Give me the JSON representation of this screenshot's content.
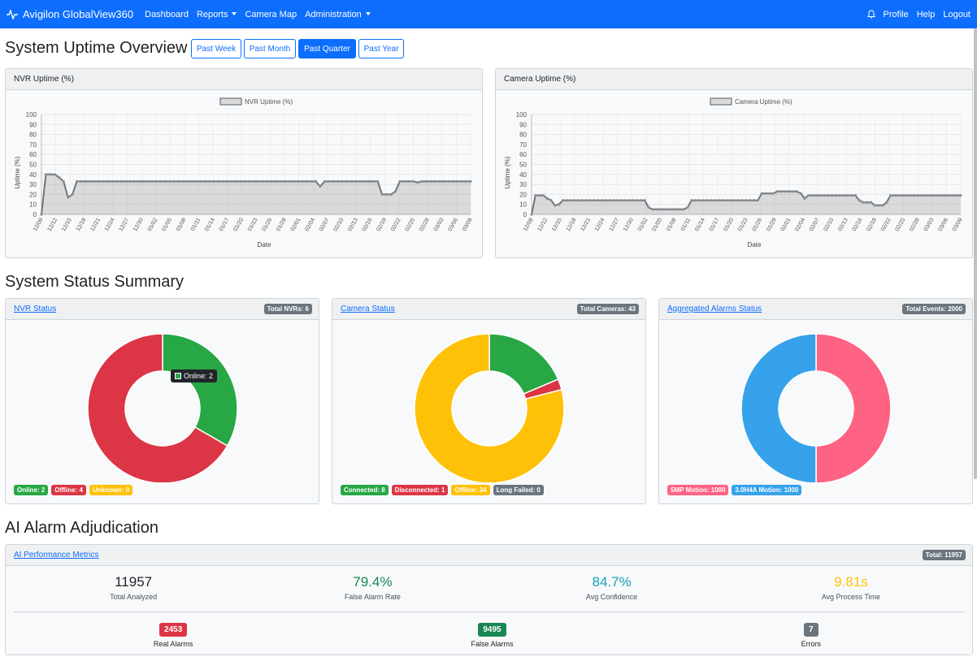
{
  "nav": {
    "brand": "Avigilon GlobalView360",
    "links": [
      "Dashboard",
      "Reports",
      "Camera Map",
      "Administration"
    ],
    "right": [
      "Profile",
      "Help",
      "Logout"
    ]
  },
  "uptime": {
    "title": "System Uptime Overview",
    "ranges": [
      "Past Week",
      "Past Month",
      "Past Quarter",
      "Past Year"
    ],
    "active_range": "Past Quarter"
  },
  "status": {
    "title": "System Status Summary"
  },
  "ai": {
    "title": "AI Alarm Adjudication"
  },
  "colors": {
    "primary": "#0d6efd",
    "success": "#28a745",
    "danger": "#dc3545",
    "warning": "#ffc107",
    "secondary": "#6c757d",
    "pink": "#ff6384",
    "blue": "#36a2eb",
    "cyan": "#17a2b8",
    "dark_green": "#198754"
  },
  "cards": {
    "nvr_uptime": {
      "header": "NVR Uptime (%)"
    },
    "camera_uptime": {
      "header": "Camera Uptime (%)"
    },
    "nvr_status": {
      "header": "NVR Status",
      "badge": "Total NVRs: 6",
      "tooltip": "Online: 2",
      "legend": [
        "Online: 2",
        "Offline: 4",
        "Unknown: 0"
      ]
    },
    "camera_status": {
      "header": "Camera Status",
      "badge": "Total Cameras: 43",
      "legend": [
        "Connected: 8",
        "Disconnected: 1",
        "Offline: 34",
        "Long Failed: 0"
      ]
    },
    "alarms_status": {
      "header": "Aggregated Alarms Status",
      "badge": "Total Events: 2000",
      "legend": [
        "5MP Motion: 1000",
        "3.0H4A Motion: 1000"
      ]
    },
    "ai_metrics": {
      "header": "AI Performance Metrics",
      "badge": "Total: 11957",
      "metrics": [
        {
          "value": "11957",
          "label": "Total Analyzed"
        },
        {
          "value": "79.4%",
          "label": "False Alarm Rate"
        },
        {
          "value": "84.7%",
          "label": "Avg Confidence"
        },
        {
          "value": "9.81s",
          "label": "Avg Process Time"
        }
      ],
      "counts": [
        {
          "value": "2453",
          "label": "Real Alarms"
        },
        {
          "value": "9495",
          "label": "False Alarms"
        },
        {
          "value": "7",
          "label": "Errors"
        }
      ]
    }
  },
  "chart_data": [
    {
      "type": "area",
      "title": "NVR Uptime (%)",
      "series_name": "NVR Uptime (%)",
      "xlabel": "Date",
      "ylabel": "Uptime (%)",
      "ylim": [
        0,
        100
      ],
      "yticks": [
        0,
        10,
        20,
        30,
        40,
        50,
        60,
        70,
        80,
        90,
        100
      ],
      "xtick_labels": [
        "12/09",
        "12/12",
        "12/15",
        "12/18",
        "12/21",
        "12/24",
        "12/27",
        "12/30",
        "01/02",
        "01/05",
        "01/08",
        "01/11",
        "01/14",
        "01/17",
        "01/20",
        "01/23",
        "01/26",
        "01/29",
        "02/01",
        "02/04",
        "02/07",
        "02/10",
        "02/13",
        "02/16",
        "02/19",
        "02/22",
        "02/25",
        "02/28",
        "03/03",
        "03/06",
        "03/09"
      ],
      "values": [
        0,
        40,
        40,
        40,
        37,
        33,
        17,
        20,
        33,
        33,
        33,
        33,
        33,
        33,
        33,
        33,
        33,
        33,
        33,
        33,
        33,
        33,
        33,
        33,
        33,
        33,
        33,
        33,
        33,
        33,
        33,
        33,
        33,
        33,
        33,
        33,
        33,
        33,
        33,
        33,
        33,
        33,
        33,
        33,
        33,
        33,
        33,
        33,
        33,
        33,
        33,
        33,
        33,
        33,
        33,
        33,
        33,
        33,
        33,
        33,
        33,
        33,
        33,
        28,
        33,
        33,
        33,
        33,
        33,
        33,
        33,
        33,
        33,
        33,
        33,
        33,
        33,
        20,
        20,
        20,
        23,
        33,
        33,
        33,
        33,
        32,
        33,
        33,
        33,
        33,
        33,
        33,
        33,
        33,
        33,
        33,
        33,
        33
      ]
    },
    {
      "type": "area",
      "title": "Camera Uptime (%)",
      "series_name": "Camera Uptime (%)",
      "xlabel": "Date",
      "ylabel": "Uptime (%)",
      "ylim": [
        0,
        100
      ],
      "yticks": [
        0,
        10,
        20,
        30,
        40,
        50,
        60,
        70,
        80,
        90,
        100
      ],
      "xtick_labels": [
        "12/09",
        "12/12",
        "12/15",
        "12/18",
        "12/21",
        "12/24",
        "12/27",
        "12/30",
        "01/02",
        "01/05",
        "01/08",
        "01/11",
        "01/14",
        "01/17",
        "01/20",
        "01/23",
        "01/26",
        "01/29",
        "02/01",
        "02/04",
        "02/07",
        "02/10",
        "02/13",
        "02/16",
        "02/19",
        "02/22",
        "02/25",
        "02/28",
        "03/03",
        "03/06",
        "03/09"
      ],
      "values": [
        0,
        19,
        19,
        19,
        16,
        14,
        9,
        10,
        14,
        14,
        14,
        14,
        14,
        14,
        14,
        14,
        14,
        14,
        14,
        14,
        14,
        14,
        14,
        14,
        14,
        14,
        14,
        14,
        14,
        14,
        7,
        5,
        5,
        5,
        5,
        5,
        5,
        5,
        5,
        5,
        7,
        14,
        14,
        14,
        14,
        14,
        14,
        14,
        14,
        14,
        14,
        14,
        14,
        14,
        14,
        14,
        14,
        14,
        14,
        21,
        21,
        21,
        21,
        23,
        23,
        23,
        23,
        23,
        23,
        21,
        16,
        19,
        19,
        19,
        19,
        19,
        19,
        19,
        19,
        19,
        19,
        19,
        19,
        19,
        14,
        12,
        12,
        12,
        9,
        9,
        9,
        12,
        19,
        19,
        19,
        19,
        19,
        19,
        19,
        19,
        19,
        19,
        19,
        19,
        19,
        19,
        19,
        19,
        19,
        19,
        19
      ]
    },
    {
      "type": "pie",
      "title": "NVR Status",
      "labels": [
        "Online",
        "Offline",
        "Unknown"
      ],
      "values": [
        2,
        4,
        0
      ],
      "colors": [
        "#28a745",
        "#dc3545",
        "#ffc107"
      ]
    },
    {
      "type": "pie",
      "title": "Camera Status",
      "labels": [
        "Connected",
        "Disconnected",
        "Offline",
        "Long Failed"
      ],
      "values": [
        8,
        1,
        34,
        0
      ],
      "colors": [
        "#28a745",
        "#dc3545",
        "#ffc107",
        "#6c757d"
      ]
    },
    {
      "type": "pie",
      "title": "Aggregated Alarms Status",
      "labels": [
        "5MP Motion",
        "3.0H4A Motion"
      ],
      "values": [
        1000,
        1000
      ],
      "colors": [
        "#ff6384",
        "#36a2eb"
      ]
    }
  ]
}
